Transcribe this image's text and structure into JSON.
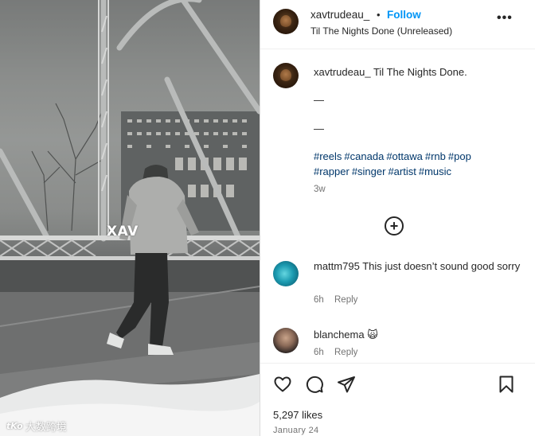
{
  "video": {
    "overlay_text": "XAV",
    "watermark_logo": "tKo",
    "watermark_text": "大数跨境"
  },
  "post": {
    "header": {
      "username": "xavtrudeau_",
      "separator": "•",
      "follow_label": "Follow",
      "audio_title": "Til The Nights Done (Unreleased)",
      "more_label": "•••"
    },
    "caption": {
      "username": "xavtrudeau_",
      "text": "Til The Nights Done.",
      "dash1": "—",
      "dash2": "—",
      "hashtags": [
        "#reels",
        "#canada",
        "#ottawa",
        "#rnb",
        "#pop",
        "#rapper",
        "#singer",
        "#artist",
        "#music"
      ],
      "age": "3w"
    },
    "load_more_icon": "plus-circle-icon",
    "comments": [
      {
        "username": "mattm795",
        "text": "This just doesn’t sound good sorry",
        "age": "6h",
        "reply_label": "Reply"
      },
      {
        "username": "blanchema",
        "text": "🙀",
        "age": "6h",
        "reply_label": "Reply"
      }
    ],
    "actions": {
      "icons": [
        "heart-icon",
        "comment-icon",
        "share-icon",
        "bookmark-icon"
      ],
      "likes": "5,297 likes",
      "date": "January 24"
    },
    "colors": {
      "follow": "#0095f6",
      "hashtag": "#00376b",
      "muted": "#737373",
      "text": "#262626"
    }
  }
}
